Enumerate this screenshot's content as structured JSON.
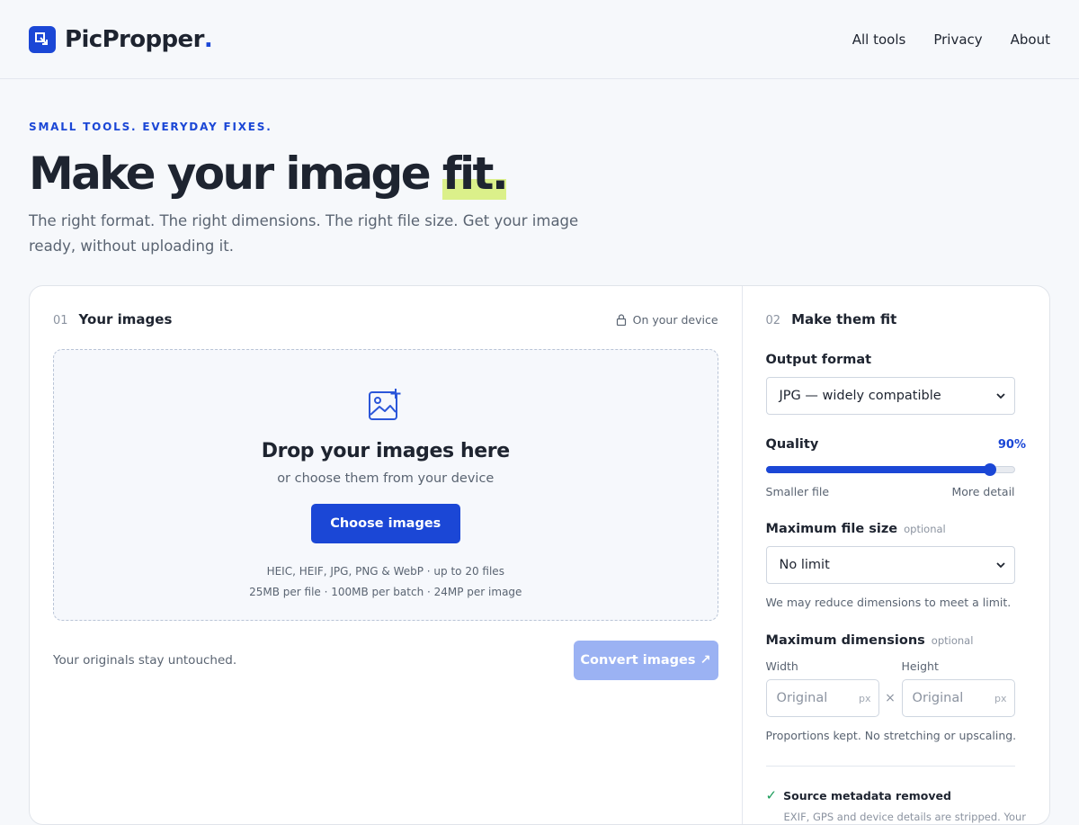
{
  "header": {
    "brand": "PicPropper",
    "brand_dot": ".",
    "nav": [
      {
        "label": "All tools"
      },
      {
        "label": "Privacy"
      },
      {
        "label": "About"
      }
    ]
  },
  "hero": {
    "eyebrow": "SMALL TOOLS. EVERYDAY FIXES.",
    "headline_start": "Make your image ",
    "headline_highlight": "fit.",
    "subhead": "The right format. The right dimensions. The right file size. Get your image ready, without uploading it."
  },
  "upload": {
    "step_num": "01",
    "step_label": "Your images",
    "device_note": "On your device",
    "drop_title": "Drop your images here",
    "drop_sub": "or choose them from your device",
    "choose_label": "Choose images",
    "limits_line1": "HEIC, HEIF, JPG, PNG & WebP · up to 20 files",
    "limits_line2": "25MB per file · 100MB per batch · 24MP per image",
    "originals_note": "Your originals stay untouched.",
    "convert_label": "Convert images ↗"
  },
  "settings": {
    "step_num": "02",
    "step_label": "Make them fit",
    "output_format_label": "Output format",
    "output_format_value": "JPG — widely compatible",
    "quality_label": "Quality",
    "quality_value": "90%",
    "quality_fraction": 0.9,
    "quality_min_label": "Smaller file",
    "quality_max_label": "More detail",
    "max_size_label": "Maximum file size",
    "max_size_optional": "optional",
    "max_size_value": "No limit",
    "max_size_hint": "We may reduce dimensions to meet a limit.",
    "max_dims_label": "Maximum dimensions",
    "max_dims_optional": "optional",
    "width_label": "Width",
    "height_label": "Height",
    "width_placeholder": "Original",
    "height_placeholder": "Original",
    "unit": "px",
    "times": "×",
    "dims_hint": "Proportions kept. No stretching or upscaling.",
    "metadata_label": "Source metadata removed",
    "metadata_sub": "EXIF, GPS and device details are stripped. Your"
  },
  "colors": {
    "accent": "#1b47d6",
    "highlight": "#dbf08a",
    "convert_disabled": "#9bb2f3",
    "check": "#1b9c5a"
  }
}
